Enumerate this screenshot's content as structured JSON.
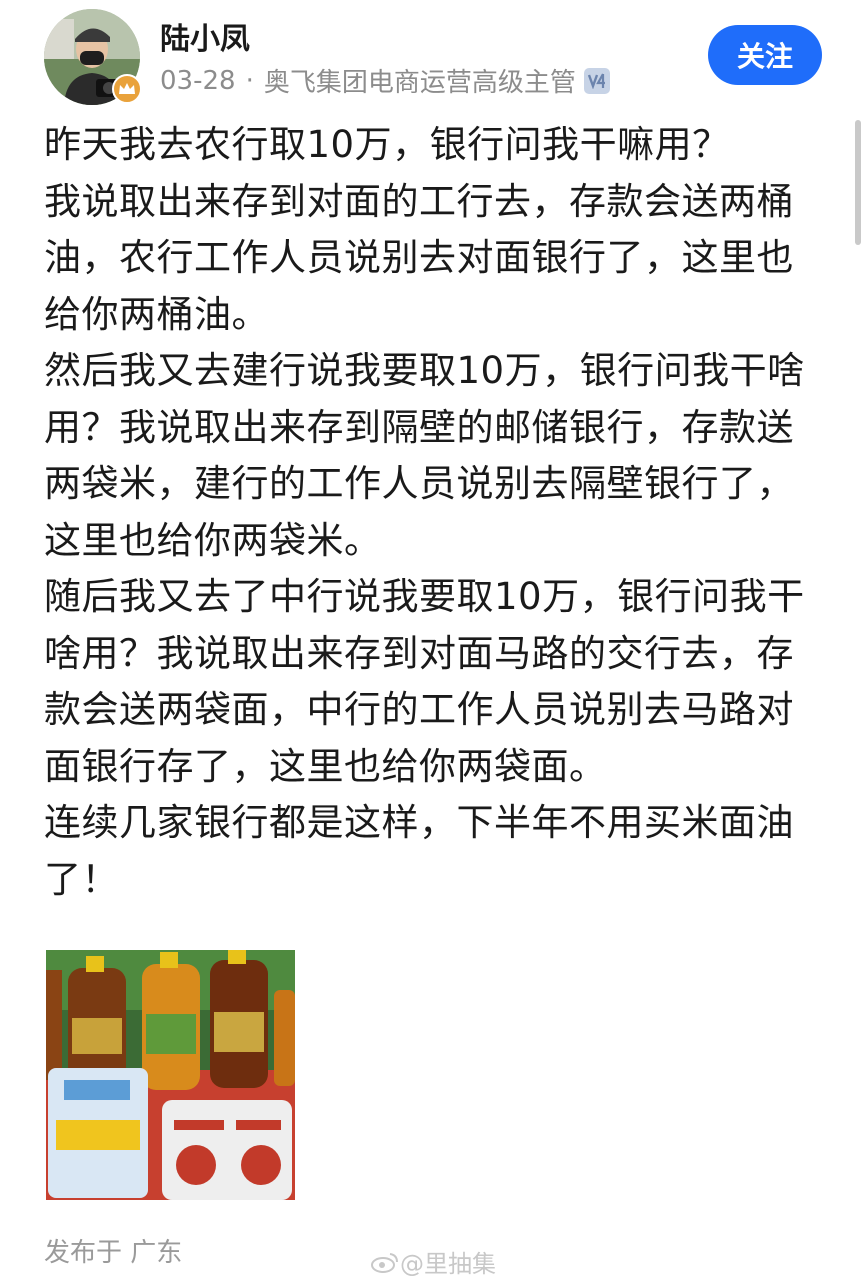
{
  "post": {
    "author": {
      "name": "陆小凤",
      "badge_icon": "crown-icon"
    },
    "date": "03-28",
    "separator": "·",
    "title": "奥飞集团电商运营高级主管",
    "verify_icon": "v4-badge-icon",
    "follow_label": "关注",
    "paragraphs": [
      "昨天我去农行取10万，银行问我干嘛用？",
      "我说取出来存到对面的工行去，存款会送两桶油，农行工作人员说别去对面银行了，这里也给你两桶油。",
      "然后我又去建行说我要取10万，银行问我干啥用？我说取出来存到隔壁的邮储银行，存款送两袋米，建行的工作人员说别去隔壁银行了，这里也给你两袋米。",
      "随后我又去了中行说我要取10万，银行问我干啥用？我说取出来存到对面马路的交行去，存款会送两袋面，中行的工作人员说别去马路对面银行存了，这里也给你两袋面。",
      "连续几家银行都是这样，下半年不用买米面油了！"
    ],
    "location": "发布于 广东",
    "watermark": "@里抽集"
  },
  "colors": {
    "accent": "#1f6dfa",
    "meta_text": "#8c8c8c",
    "badge": "#e9a23b"
  }
}
